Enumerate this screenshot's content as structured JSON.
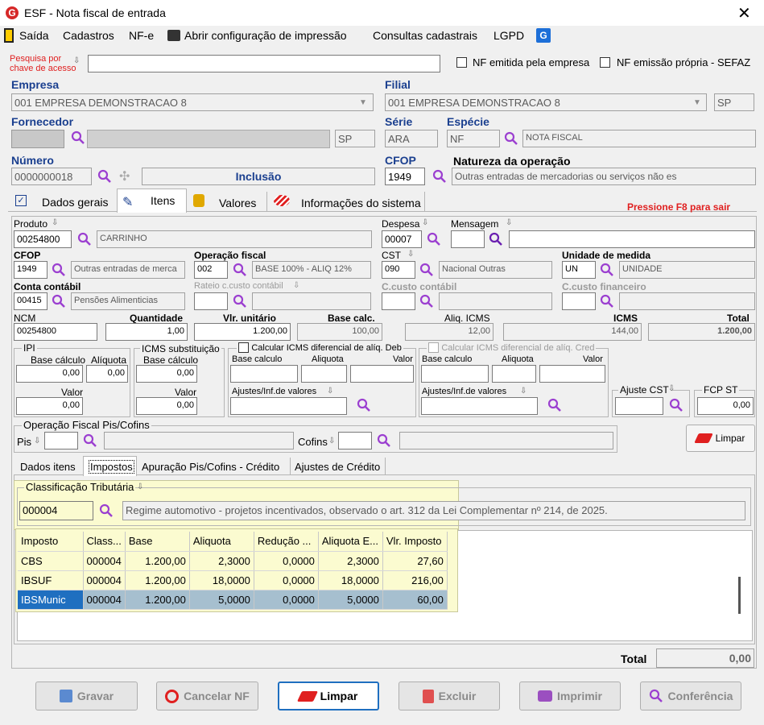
{
  "window": {
    "title": "ESF - Nota fiscal de entrada"
  },
  "menu": {
    "saida": "Saída",
    "cadastros": "Cadastros",
    "nfe": "NF-e",
    "abrir_impressao": "Abrir configuração de impressão",
    "consultas": "Consultas cadastrais",
    "lgpd": "LGPD"
  },
  "search": {
    "label_l1": "Pesquisa por",
    "label_l2": "chave de acesso",
    "value": ""
  },
  "checks": {
    "nf_emitida": "NF emitida pela empresa",
    "nf_propria": "NF emissão própria - SEFAZ"
  },
  "empresa": {
    "label": "Empresa",
    "value": "001 EMPRESA DEMONSTRACAO 8"
  },
  "filial": {
    "label": "Filial",
    "value": "001 EMPRESA DEMONSTRACAO 8",
    "uf": "SP"
  },
  "fornecedor": {
    "label": "Fornecedor",
    "uf": "SP"
  },
  "serie": {
    "label": "Série",
    "value": "ARA"
  },
  "especie": {
    "label": "Espécie",
    "code": "NF",
    "desc": "NOTA FISCAL"
  },
  "numero": {
    "label": "Número",
    "value": "0000000018",
    "status": "Inclusão"
  },
  "cfop": {
    "label": "CFOP",
    "value": "1949"
  },
  "natureza": {
    "label": "Natureza da operação",
    "value": "Outras entradas  de mercadorias ou serviços não es"
  },
  "tabs_main": {
    "dados_gerais": "Dados gerais",
    "itens": "Itens",
    "valores": "Valores",
    "info_sistema": "Informações do sistema"
  },
  "f8_hint": "Pressione F8 para sair",
  "item": {
    "produto_label": "Produto",
    "produto_code": "00254800",
    "produto_desc": "CARRINHO",
    "despesa_label": "Despesa",
    "despesa_code": "00007",
    "mensagem_label": "Mensagem",
    "cfop_label": "CFOP",
    "cfop_code": "1949",
    "cfop_desc": "Outras entradas  de merca",
    "opfiscal_label": "Operação fiscal",
    "opfiscal_code": "002",
    "opfiscal_desc": "BASE 100% - ALIQ 12%",
    "cst_label": "CST",
    "cst_code": "090",
    "cst_desc": "Nacional Outras",
    "unidade_label": "Unidade de medida",
    "unidade_code": "UN",
    "unidade_desc": "UNIDADE",
    "conta_label": "Conta contábil",
    "conta_code": "00415",
    "conta_desc": "Pensões Alimenticias",
    "rateio_label": "Rateio c.custo contábil",
    "ccusto_label": "C.custo contábil",
    "ccusto_fin_label": "C.custo financeiro",
    "ncm_label": "NCM",
    "ncm_value": "00254800",
    "qtd_label": "Quantidade",
    "qtd_value": "1,00",
    "vlr_unit_label": "Vlr. unitário",
    "vlr_unit_value": "1.200,00",
    "base_calc_label": "Base calc.",
    "base_calc_value": "100,00",
    "aliq_icms_label": "Aliq. ICMS",
    "aliq_icms_value": "12,00",
    "icms_label": "ICMS",
    "icms_value": "144,00",
    "total_label": "Total",
    "total_value": "1.200,00"
  },
  "ipi": {
    "title": "IPI",
    "base_label": "Base cálculo",
    "aliq_label": "Alíquota",
    "base_value": "0,00",
    "aliq_value": "0,00",
    "valor_label": "Valor",
    "valor_value": "0,00"
  },
  "icms_st": {
    "title": "ICMS substituição",
    "base_label": "Base cálculo",
    "base_value": "0,00",
    "valor_label": "Valor",
    "valor_value": "0,00"
  },
  "difal_deb": {
    "title": "Calcular ICMS diferencial de alíq. Deb",
    "base_label": "Base calculo",
    "aliq_label": "Aliquota",
    "valor_label": "Valor",
    "ajustes_label": "Ajustes/Inf.de valores"
  },
  "difal_cred": {
    "title": "Calcular ICMS diferencial de alíq. Cred",
    "base_label": "Base calculo",
    "aliq_label": "Aliquota",
    "valor_label": "Valor",
    "ajustes_label": "Ajustes/Inf.de valores"
  },
  "ajuste_cst": {
    "title": "Ajuste CST"
  },
  "fcp_st": {
    "title": "FCP ST",
    "value": "0,00"
  },
  "pis_cofins": {
    "title": "Operação Fiscal Pis/Cofins",
    "pis_label": "Pis",
    "cofins_label": "Cofins"
  },
  "limpar_small": "Limpar",
  "tabs_item": {
    "dados_itens": "Dados itens",
    "impostos": "Impostos",
    "apuracao": "Apuração Pis/Cofins - Crédito",
    "ajustes": "Ajustes de Crédito"
  },
  "class_trib": {
    "title": "Classificação Tributária",
    "code": "000004",
    "desc": "Regime automotivo - projetos incentivados, observado o art. 312 da Lei Complementar nº 214, de 2025."
  },
  "tax_table": {
    "headers": [
      "Imposto",
      "Class...",
      "Base",
      "Aliquota",
      "Redução ...",
      "Aliquota E...",
      "Vlr. Imposto"
    ],
    "rows": [
      [
        "CBS",
        "000004",
        "1.200,00",
        "2,3000",
        "0,0000",
        "2,3000",
        "27,60"
      ],
      [
        "IBSUF",
        "000004",
        "1.200,00",
        "18,0000",
        "0,0000",
        "18,0000",
        "216,00"
      ],
      [
        "IBSMunic",
        "000004",
        "1.200,00",
        "5,0000",
        "0,0000",
        "5,0000",
        "60,00"
      ]
    ]
  },
  "footer_total": {
    "label": "Total",
    "value": "0,00"
  },
  "buttons": {
    "gravar": "Gravar",
    "cancelar": "Cancelar NF",
    "limpar": "Limpar",
    "excluir": "Excluir",
    "imprimir": "Imprimir",
    "conferencia": "Conferência"
  },
  "colors": {
    "accent_blue": "#1a3f8f",
    "red": "#e02020",
    "magnifier": "#9b3fd0",
    "highlight": "#fbfbd0"
  }
}
